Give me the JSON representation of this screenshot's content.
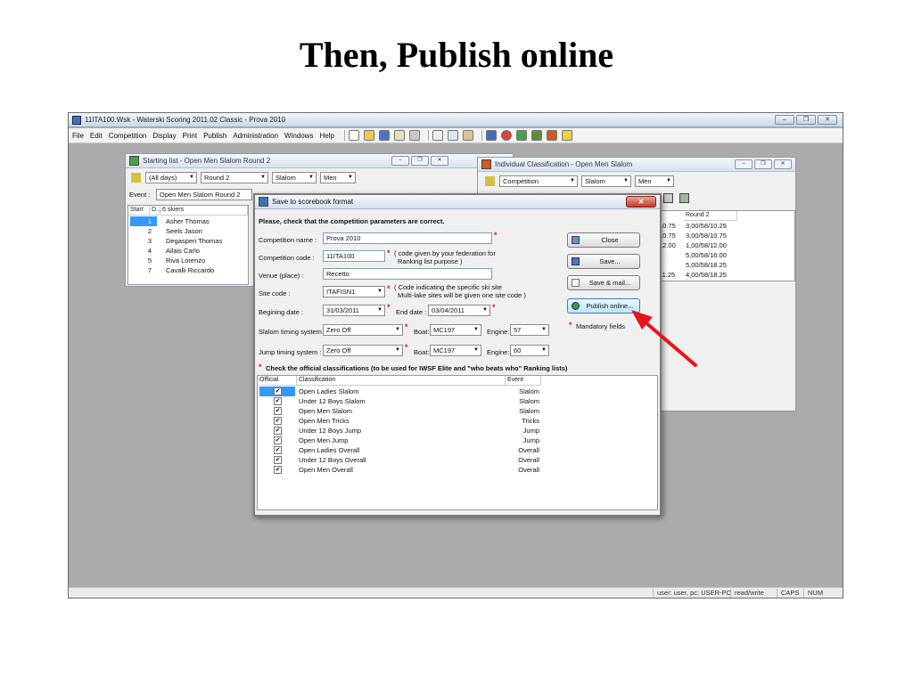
{
  "slide": {
    "title": "Then, Publish online"
  },
  "app": {
    "title": "11ITA100.Wsk - Waterski Scoring 2011.02 Classic - Prova 2010",
    "menu": [
      "File",
      "Edit",
      "Competition",
      "Display",
      "Print",
      "Publish",
      "Administration",
      "Windows",
      "Help"
    ],
    "status": [
      "user: user, pc: USER-PC",
      "read/write",
      "CAPS",
      "NUM"
    ]
  },
  "starting_list": {
    "title": "Starting list - Open Men Slalom Round 2",
    "days": "(All days)",
    "round": "Round 2",
    "event": "Slalom",
    "category": "Men",
    "event_label": "Event :",
    "event_value": "Open Men Slalom Round 2",
    "headers": [
      "Start",
      "D...",
      "6 skiers"
    ],
    "rows": [
      {
        "start": "1",
        "name": "Asher Thomas"
      },
      {
        "start": "2",
        "name": "Seels Jason"
      },
      {
        "start": "3",
        "name": "Degasperi Thomas"
      },
      {
        "start": "4",
        "name": "Allais Carlo"
      },
      {
        "start": "5",
        "name": "Riva Lorenzo"
      },
      {
        "start": "7",
        "name": "Cavalli Riccardo"
      }
    ]
  },
  "individual": {
    "title": "Individual Classification - Open Men Slalom",
    "filter": "Competition",
    "event": "Slalom",
    "category": "Men",
    "col_header": "Round 2",
    "left_values": [
      "10.75",
      "10.75",
      "12.00",
      "",
      "",
      "11.25"
    ],
    "values": [
      "3,00/58/10.25",
      "3,00/58/10.75",
      "1,00/58/12.00",
      "5,00/58/16.00",
      "5,00/58/18.25",
      "4,00/58/18.25"
    ]
  },
  "dialog": {
    "title": "Save to scorebook format",
    "heading": "Please, check that the competition parameters are correct.",
    "competition_name_label": "Competition name :",
    "competition_name": "Prova 2010",
    "competition_code_label": "Competition code :",
    "competition_code": "11ITA100",
    "competition_code_note1": "( code given by your federation for",
    "competition_code_note2": "Ranking list purpose )",
    "venue_label": "Venue (place) :",
    "venue": "Recetto",
    "site_code_label": "Site code :",
    "site_code": "ITAFISN1",
    "site_code_note1": "( Code indicating the specific ski site",
    "site_code_note2": "Multi-lake sites will be given one site code )",
    "begin_label": "Begining date :",
    "begin_date": "31/03/2011",
    "end_label": "End date :",
    "end_date": "03/04/2011",
    "slalom_timing_label": "Slalom timing system :",
    "slalom_timing": "Zero Off",
    "jump_timing_label": "Jump timing system :",
    "jump_timing": "Zero Off",
    "boat_label": "Boat:",
    "slalom_boat": "MC197",
    "jump_boat": "MC197",
    "engine_label": "Engine:",
    "slalom_engine": "57",
    "jump_engine": "60",
    "buttons": {
      "close": "Close",
      "save": "Save...",
      "save_mail": "Save & mail...",
      "publish": "Publish online..."
    },
    "mandatory": "Mandatory fields",
    "check_heading": "Check the official classifications (to be used for IWSF Elite and \"who beats who\" Ranking lists)",
    "list_headers": [
      "Official",
      "Classification",
      "Event"
    ],
    "classifications": [
      {
        "name": "Open Ladies Slalom",
        "event": "Slalom"
      },
      {
        "name": "Under 12 Boys Slalom",
        "event": "Slalom"
      },
      {
        "name": "Open Men Slalom",
        "event": "Slalom"
      },
      {
        "name": "Open Men Tricks",
        "event": "Tricks"
      },
      {
        "name": "Under 12 Boys Jump",
        "event": "Jump"
      },
      {
        "name": "Open Men Jump",
        "event": "Jump"
      },
      {
        "name": "Open Ladies Overall",
        "event": "Overall"
      },
      {
        "name": "Under 12 Boys Overall",
        "event": "Overall"
      },
      {
        "name": "Open Men Overall",
        "event": "Overall"
      }
    ]
  },
  "colors": {
    "accent_arrow": "#e8141b",
    "selection": "#3399ff",
    "mandatory_star": "#e02020"
  }
}
